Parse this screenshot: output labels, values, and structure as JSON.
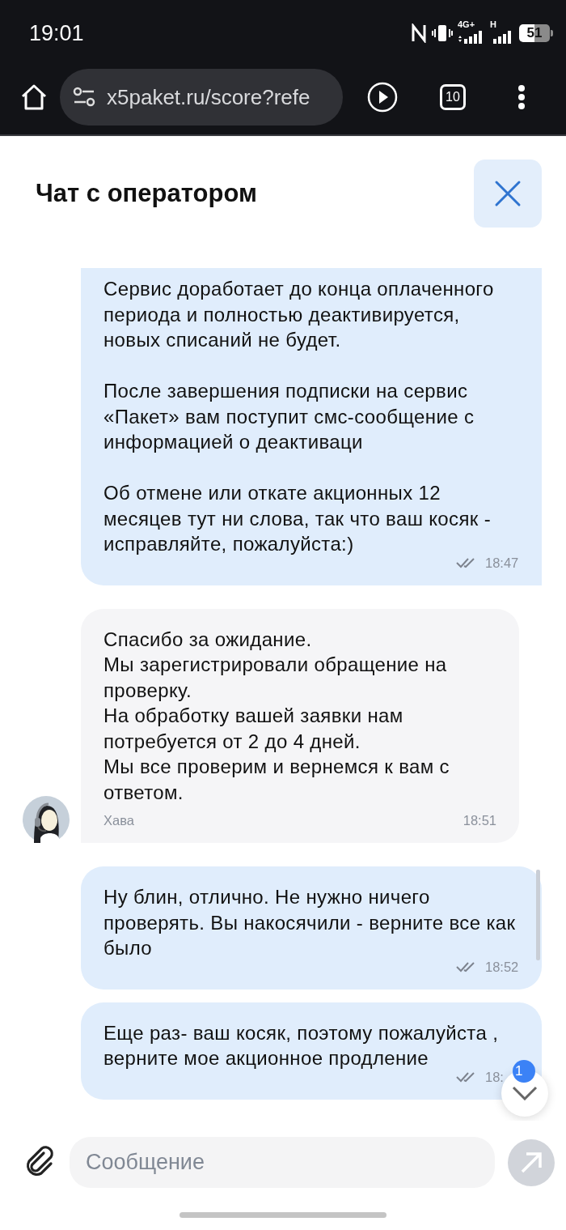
{
  "status_bar": {
    "time": "19:01",
    "network_1": "4G+",
    "network_2": "H",
    "battery": "51"
  },
  "browser": {
    "url": "x5paket.ru/score?refe",
    "tab_count": "10"
  },
  "chat": {
    "title": "Чат с оператором"
  },
  "messages": [
    {
      "kind": "outgoing",
      "text": "Сервис доработает до конца оплаченного периода и полностью деактивируется, новых списаний не будет.\n\nПосле завершения подписки на сервис «Пакет» вам поступит смс-сообщение с информацией о деактиваци\n\nОб отмене или откате акционных 12 месяцев тут ни слова, так что ваш косяк - исправляйте, пожалуйста:)",
      "time": "18:47",
      "read": true
    },
    {
      "kind": "incoming",
      "text": "Спасибо за ожидание.\nМы зарегистрировали обращение на проверку.\nНа обработку вашей заявки нам потребуется от 2 до 4 дней.\nМы все проверим и вернемся к вам с ответом.",
      "sender": "Хава",
      "time": "18:51"
    },
    {
      "kind": "outgoing",
      "text": "Ну блин, отлично. Не нужно ничего проверять. Вы накосячили - верните все как было",
      "time": "18:52",
      "read": true
    },
    {
      "kind": "outgoing",
      "text": "Еще раз- ваш косяк, поэтому пожалуйста , верните мое акционное продление",
      "time": "18:",
      "read": true
    }
  ],
  "scroll_button": {
    "badge": "1"
  },
  "composer": {
    "placeholder": "Сообщение"
  }
}
